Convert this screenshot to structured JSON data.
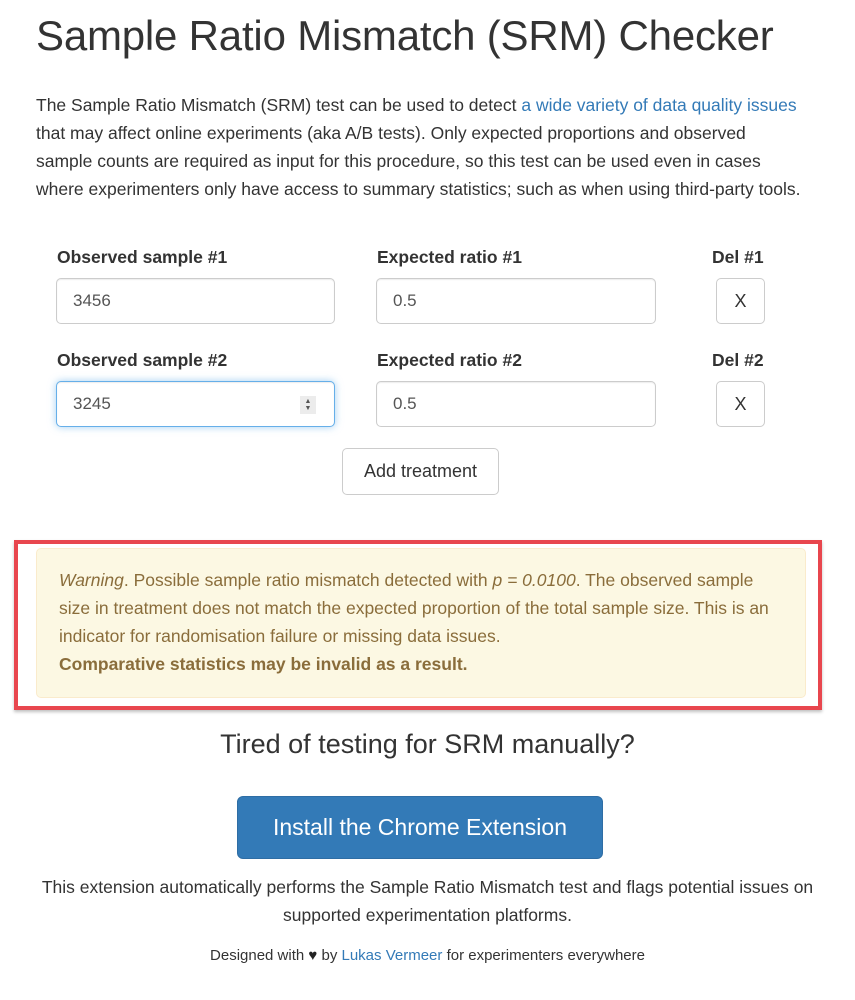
{
  "page": {
    "title": "Sample Ratio Mismatch (SRM) Checker"
  },
  "intro": {
    "text_before_link": "The Sample Ratio Mismatch (SRM) test can be used to detect ",
    "link_text": "a wide variety of data quality issues",
    "text_after_link": " that may affect online experiments (aka A/B tests). Only expected proportions and observed sample counts are required as input for this procedure, so this test can be used even in cases where experimenters only have access to summary statistics; such as when using third-party tools."
  },
  "rows": [
    {
      "observed_label": "Observed sample #1",
      "observed_value": "3456",
      "expected_label": "Expected ratio #1",
      "expected_value": "0.5",
      "delete_label": "Del #1",
      "delete_button": "X"
    },
    {
      "observed_label": "Observed sample #2",
      "observed_value": "3245",
      "expected_label": "Expected ratio #2",
      "expected_value": "0.5",
      "delete_label": "Del #2",
      "delete_button": "X"
    }
  ],
  "add_treatment_label": "Add treatment",
  "alert": {
    "warning_word": "Warning",
    "text_1": ". Possible sample ratio mismatch detected with ",
    "p_value": "p = 0.0100",
    "text_2": ". The observed sample size in treatment does not match the expected proportion of the total sample size. This is an indicator for randomisation failure or missing data issues.",
    "bold_text": "Comparative statistics may be invalid as a result.",
    "highlight_color": "#e8464e",
    "background_color": "#fcf8e3",
    "text_color": "#8a6d3b"
  },
  "cta": {
    "heading": "Tired of testing for SRM manually?",
    "button_label": "Install the Chrome Extension",
    "button_color": "#337ab7",
    "description": "This extension automatically performs the Sample Ratio Mismatch test and flags potential issues on supported experimentation platforms."
  },
  "footer": {
    "prefix": "Designed with",
    "heart_icon": "♥",
    "by": "by",
    "author_link": "Lukas Vermeer",
    "suffix": "for experimenters everywhere"
  }
}
